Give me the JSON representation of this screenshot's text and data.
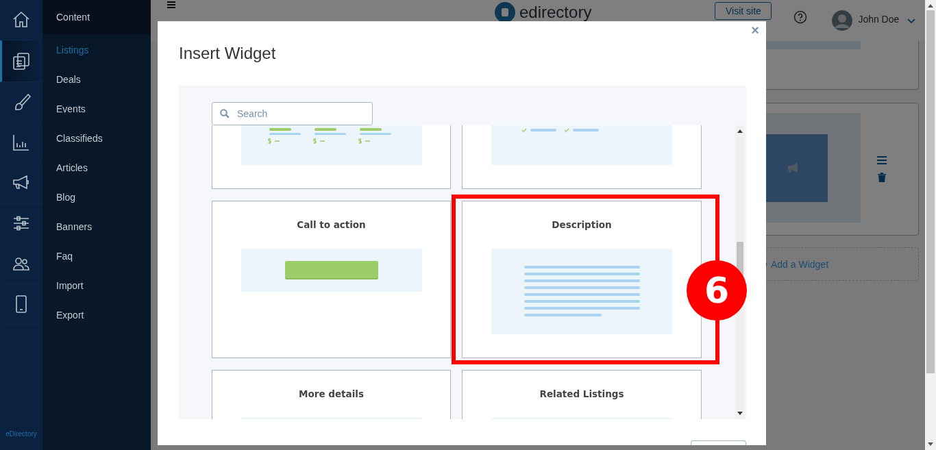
{
  "sidebar": {
    "rail_items": [
      {
        "kind": "home",
        "selected": false
      },
      {
        "kind": "documents",
        "selected": true
      },
      {
        "kind": "brush",
        "selected": false
      },
      {
        "kind": "chart",
        "selected": false
      },
      {
        "kind": "megaphone",
        "selected": false
      },
      {
        "kind": "sliders",
        "selected": false
      },
      {
        "kind": "users",
        "selected": false
      },
      {
        "kind": "phone",
        "selected": false
      }
    ],
    "heading": "Content",
    "items": [
      {
        "label": "Listings",
        "selected": true
      },
      {
        "label": "Deals",
        "selected": false
      },
      {
        "label": "Events",
        "selected": false
      },
      {
        "label": "Classifieds",
        "selected": false
      },
      {
        "label": "Articles",
        "selected": false
      },
      {
        "label": "Blog",
        "selected": false
      },
      {
        "label": "Banners",
        "selected": false
      },
      {
        "label": "Faq",
        "selected": false
      },
      {
        "label": "Import",
        "selected": false
      },
      {
        "label": "Export",
        "selected": false
      }
    ],
    "footer": "eDirectory"
  },
  "header": {
    "logo_text": "edirectory",
    "visit_button": "Visit site",
    "user_name": "John Doe"
  },
  "background": {
    "add_widget": "Add a Widget"
  },
  "modal": {
    "title": "Insert Widget",
    "close": "×",
    "search_placeholder": "Search",
    "widgets": [
      {
        "kind": "prices"
      },
      {
        "kind": "checks"
      },
      {
        "title": "Call to action",
        "kind": "button"
      },
      {
        "title": "Description",
        "kind": "lines"
      },
      {
        "title": "More details",
        "kind": "blank"
      },
      {
        "title": "Related Listings",
        "kind": "blank"
      }
    ]
  },
  "annotation": {
    "step": "6"
  }
}
